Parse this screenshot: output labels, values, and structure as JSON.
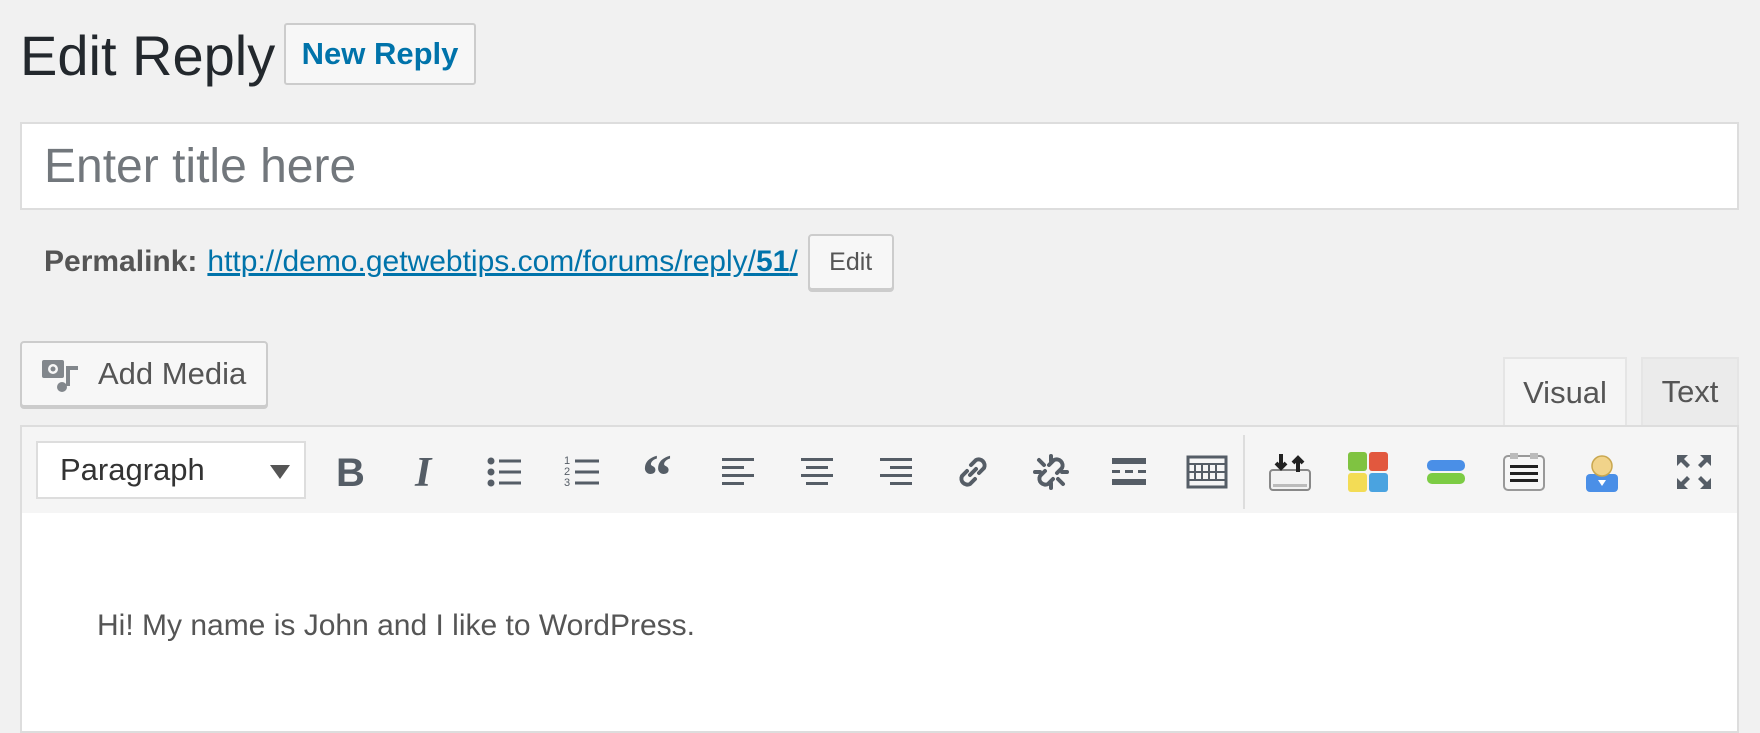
{
  "header": {
    "title": "Edit Reply",
    "new_reply_label": "New Reply"
  },
  "title_field": {
    "placeholder": "Enter title here",
    "value": ""
  },
  "permalink": {
    "label": "Permalink:",
    "url_prefix": "http://demo.getwebtips.com/forums/reply/",
    "url_id": "51",
    "url_suffix": "/",
    "edit_label": "Edit"
  },
  "media": {
    "add_media_label": "Add Media"
  },
  "tabs": {
    "visual_label": "Visual",
    "text_label": "Text"
  },
  "toolbar": {
    "format_selected": "Paragraph"
  },
  "editor": {
    "content": "Hi! My name is John and I like to WordPress."
  },
  "colors": {
    "link": "#0073aa",
    "background": "#f1f1f1",
    "icon": "#555d66"
  }
}
